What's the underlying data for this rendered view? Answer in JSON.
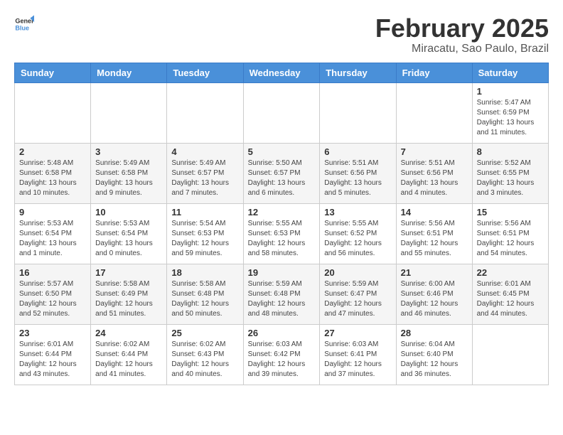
{
  "logo": {
    "line1": "General",
    "line2": "Blue"
  },
  "title": "February 2025",
  "subtitle": "Miracatu, Sao Paulo, Brazil",
  "days_of_week": [
    "Sunday",
    "Monday",
    "Tuesday",
    "Wednesday",
    "Thursday",
    "Friday",
    "Saturday"
  ],
  "weeks": [
    [
      {
        "day": "",
        "info": ""
      },
      {
        "day": "",
        "info": ""
      },
      {
        "day": "",
        "info": ""
      },
      {
        "day": "",
        "info": ""
      },
      {
        "day": "",
        "info": ""
      },
      {
        "day": "",
        "info": ""
      },
      {
        "day": "1",
        "info": "Sunrise: 5:47 AM\nSunset: 6:59 PM\nDaylight: 13 hours\nand 11 minutes."
      }
    ],
    [
      {
        "day": "2",
        "info": "Sunrise: 5:48 AM\nSunset: 6:58 PM\nDaylight: 13 hours\nand 10 minutes."
      },
      {
        "day": "3",
        "info": "Sunrise: 5:49 AM\nSunset: 6:58 PM\nDaylight: 13 hours\nand 9 minutes."
      },
      {
        "day": "4",
        "info": "Sunrise: 5:49 AM\nSunset: 6:57 PM\nDaylight: 13 hours\nand 7 minutes."
      },
      {
        "day": "5",
        "info": "Sunrise: 5:50 AM\nSunset: 6:57 PM\nDaylight: 13 hours\nand 6 minutes."
      },
      {
        "day": "6",
        "info": "Sunrise: 5:51 AM\nSunset: 6:56 PM\nDaylight: 13 hours\nand 5 minutes."
      },
      {
        "day": "7",
        "info": "Sunrise: 5:51 AM\nSunset: 6:56 PM\nDaylight: 13 hours\nand 4 minutes."
      },
      {
        "day": "8",
        "info": "Sunrise: 5:52 AM\nSunset: 6:55 PM\nDaylight: 13 hours\nand 3 minutes."
      }
    ],
    [
      {
        "day": "9",
        "info": "Sunrise: 5:53 AM\nSunset: 6:54 PM\nDaylight: 13 hours\nand 1 minute."
      },
      {
        "day": "10",
        "info": "Sunrise: 5:53 AM\nSunset: 6:54 PM\nDaylight: 13 hours\nand 0 minutes."
      },
      {
        "day": "11",
        "info": "Sunrise: 5:54 AM\nSunset: 6:53 PM\nDaylight: 12 hours\nand 59 minutes."
      },
      {
        "day": "12",
        "info": "Sunrise: 5:55 AM\nSunset: 6:53 PM\nDaylight: 12 hours\nand 58 minutes."
      },
      {
        "day": "13",
        "info": "Sunrise: 5:55 AM\nSunset: 6:52 PM\nDaylight: 12 hours\nand 56 minutes."
      },
      {
        "day": "14",
        "info": "Sunrise: 5:56 AM\nSunset: 6:51 PM\nDaylight: 12 hours\nand 55 minutes."
      },
      {
        "day": "15",
        "info": "Sunrise: 5:56 AM\nSunset: 6:51 PM\nDaylight: 12 hours\nand 54 minutes."
      }
    ],
    [
      {
        "day": "16",
        "info": "Sunrise: 5:57 AM\nSunset: 6:50 PM\nDaylight: 12 hours\nand 52 minutes."
      },
      {
        "day": "17",
        "info": "Sunrise: 5:58 AM\nSunset: 6:49 PM\nDaylight: 12 hours\nand 51 minutes."
      },
      {
        "day": "18",
        "info": "Sunrise: 5:58 AM\nSunset: 6:48 PM\nDaylight: 12 hours\nand 50 minutes."
      },
      {
        "day": "19",
        "info": "Sunrise: 5:59 AM\nSunset: 6:48 PM\nDaylight: 12 hours\nand 48 minutes."
      },
      {
        "day": "20",
        "info": "Sunrise: 5:59 AM\nSunset: 6:47 PM\nDaylight: 12 hours\nand 47 minutes."
      },
      {
        "day": "21",
        "info": "Sunrise: 6:00 AM\nSunset: 6:46 PM\nDaylight: 12 hours\nand 46 minutes."
      },
      {
        "day": "22",
        "info": "Sunrise: 6:01 AM\nSunset: 6:45 PM\nDaylight: 12 hours\nand 44 minutes."
      }
    ],
    [
      {
        "day": "23",
        "info": "Sunrise: 6:01 AM\nSunset: 6:44 PM\nDaylight: 12 hours\nand 43 minutes."
      },
      {
        "day": "24",
        "info": "Sunrise: 6:02 AM\nSunset: 6:44 PM\nDaylight: 12 hours\nand 41 minutes."
      },
      {
        "day": "25",
        "info": "Sunrise: 6:02 AM\nSunset: 6:43 PM\nDaylight: 12 hours\nand 40 minutes."
      },
      {
        "day": "26",
        "info": "Sunrise: 6:03 AM\nSunset: 6:42 PM\nDaylight: 12 hours\nand 39 minutes."
      },
      {
        "day": "27",
        "info": "Sunrise: 6:03 AM\nSunset: 6:41 PM\nDaylight: 12 hours\nand 37 minutes."
      },
      {
        "day": "28",
        "info": "Sunrise: 6:04 AM\nSunset: 6:40 PM\nDaylight: 12 hours\nand 36 minutes."
      },
      {
        "day": "",
        "info": ""
      }
    ]
  ]
}
